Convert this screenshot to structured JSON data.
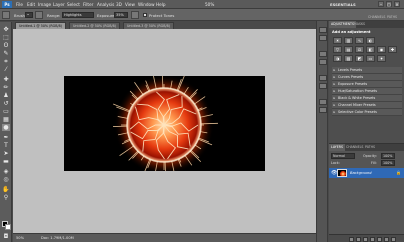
{
  "app": {
    "logo": "Ps",
    "menus": [
      "File",
      "Edit",
      "Image",
      "Layer",
      "Select",
      "Filter",
      "Analysis",
      "3D",
      "View",
      "Window",
      "Help"
    ],
    "zoom_menu": "50%",
    "workspace": "ESSENTIALS"
  },
  "options": {
    "brush_label": "Brush:",
    "mode_label": "Range:",
    "mode_value": "Highlights",
    "exposure_label": "Exposure:",
    "exposure_value": "35%",
    "protect_tones": "Protect Tones"
  },
  "document": {
    "tabs": [
      "Untitled-1 @ 50% (RGB/8)",
      "Untitled-2 @ 50% (RGB/8)",
      "Untitled-3 @ 50% (RGB/8)"
    ],
    "zoom": "50%",
    "doc_size": "Doc: 1.79M/1.00M"
  },
  "panels": {
    "top_tabs": [
      "ADJUSTMENTS",
      "MASKS"
    ],
    "top_right_tabs": [
      "CHANNELS",
      "PATHS"
    ],
    "adjustments_title": "Add an adjustment",
    "presets": [
      "Levels Presets",
      "Curves Presets",
      "Exposure Presets",
      "Hue/Saturation Presets",
      "Black & White Presets",
      "Channel Mixer Presets",
      "Selective Color Presets"
    ],
    "layers_tabs": [
      "LAYERS",
      "CHANNELS",
      "PATHS"
    ],
    "blend_mode": "Normal",
    "opacity_label": "Opacity:",
    "opacity_value": "100%",
    "lock_label": "Lock:",
    "fill_label": "Fill:",
    "fill_value": "100%",
    "layer_name": "Background"
  },
  "colors": {
    "accent": "#2f69b6",
    "canvas_bg": "#c0c0c0",
    "image_bg": "#000000",
    "fire_core": "#ffb060",
    "fire_mid": "#e53a10",
    "fire_outer": "#7a0a00"
  }
}
